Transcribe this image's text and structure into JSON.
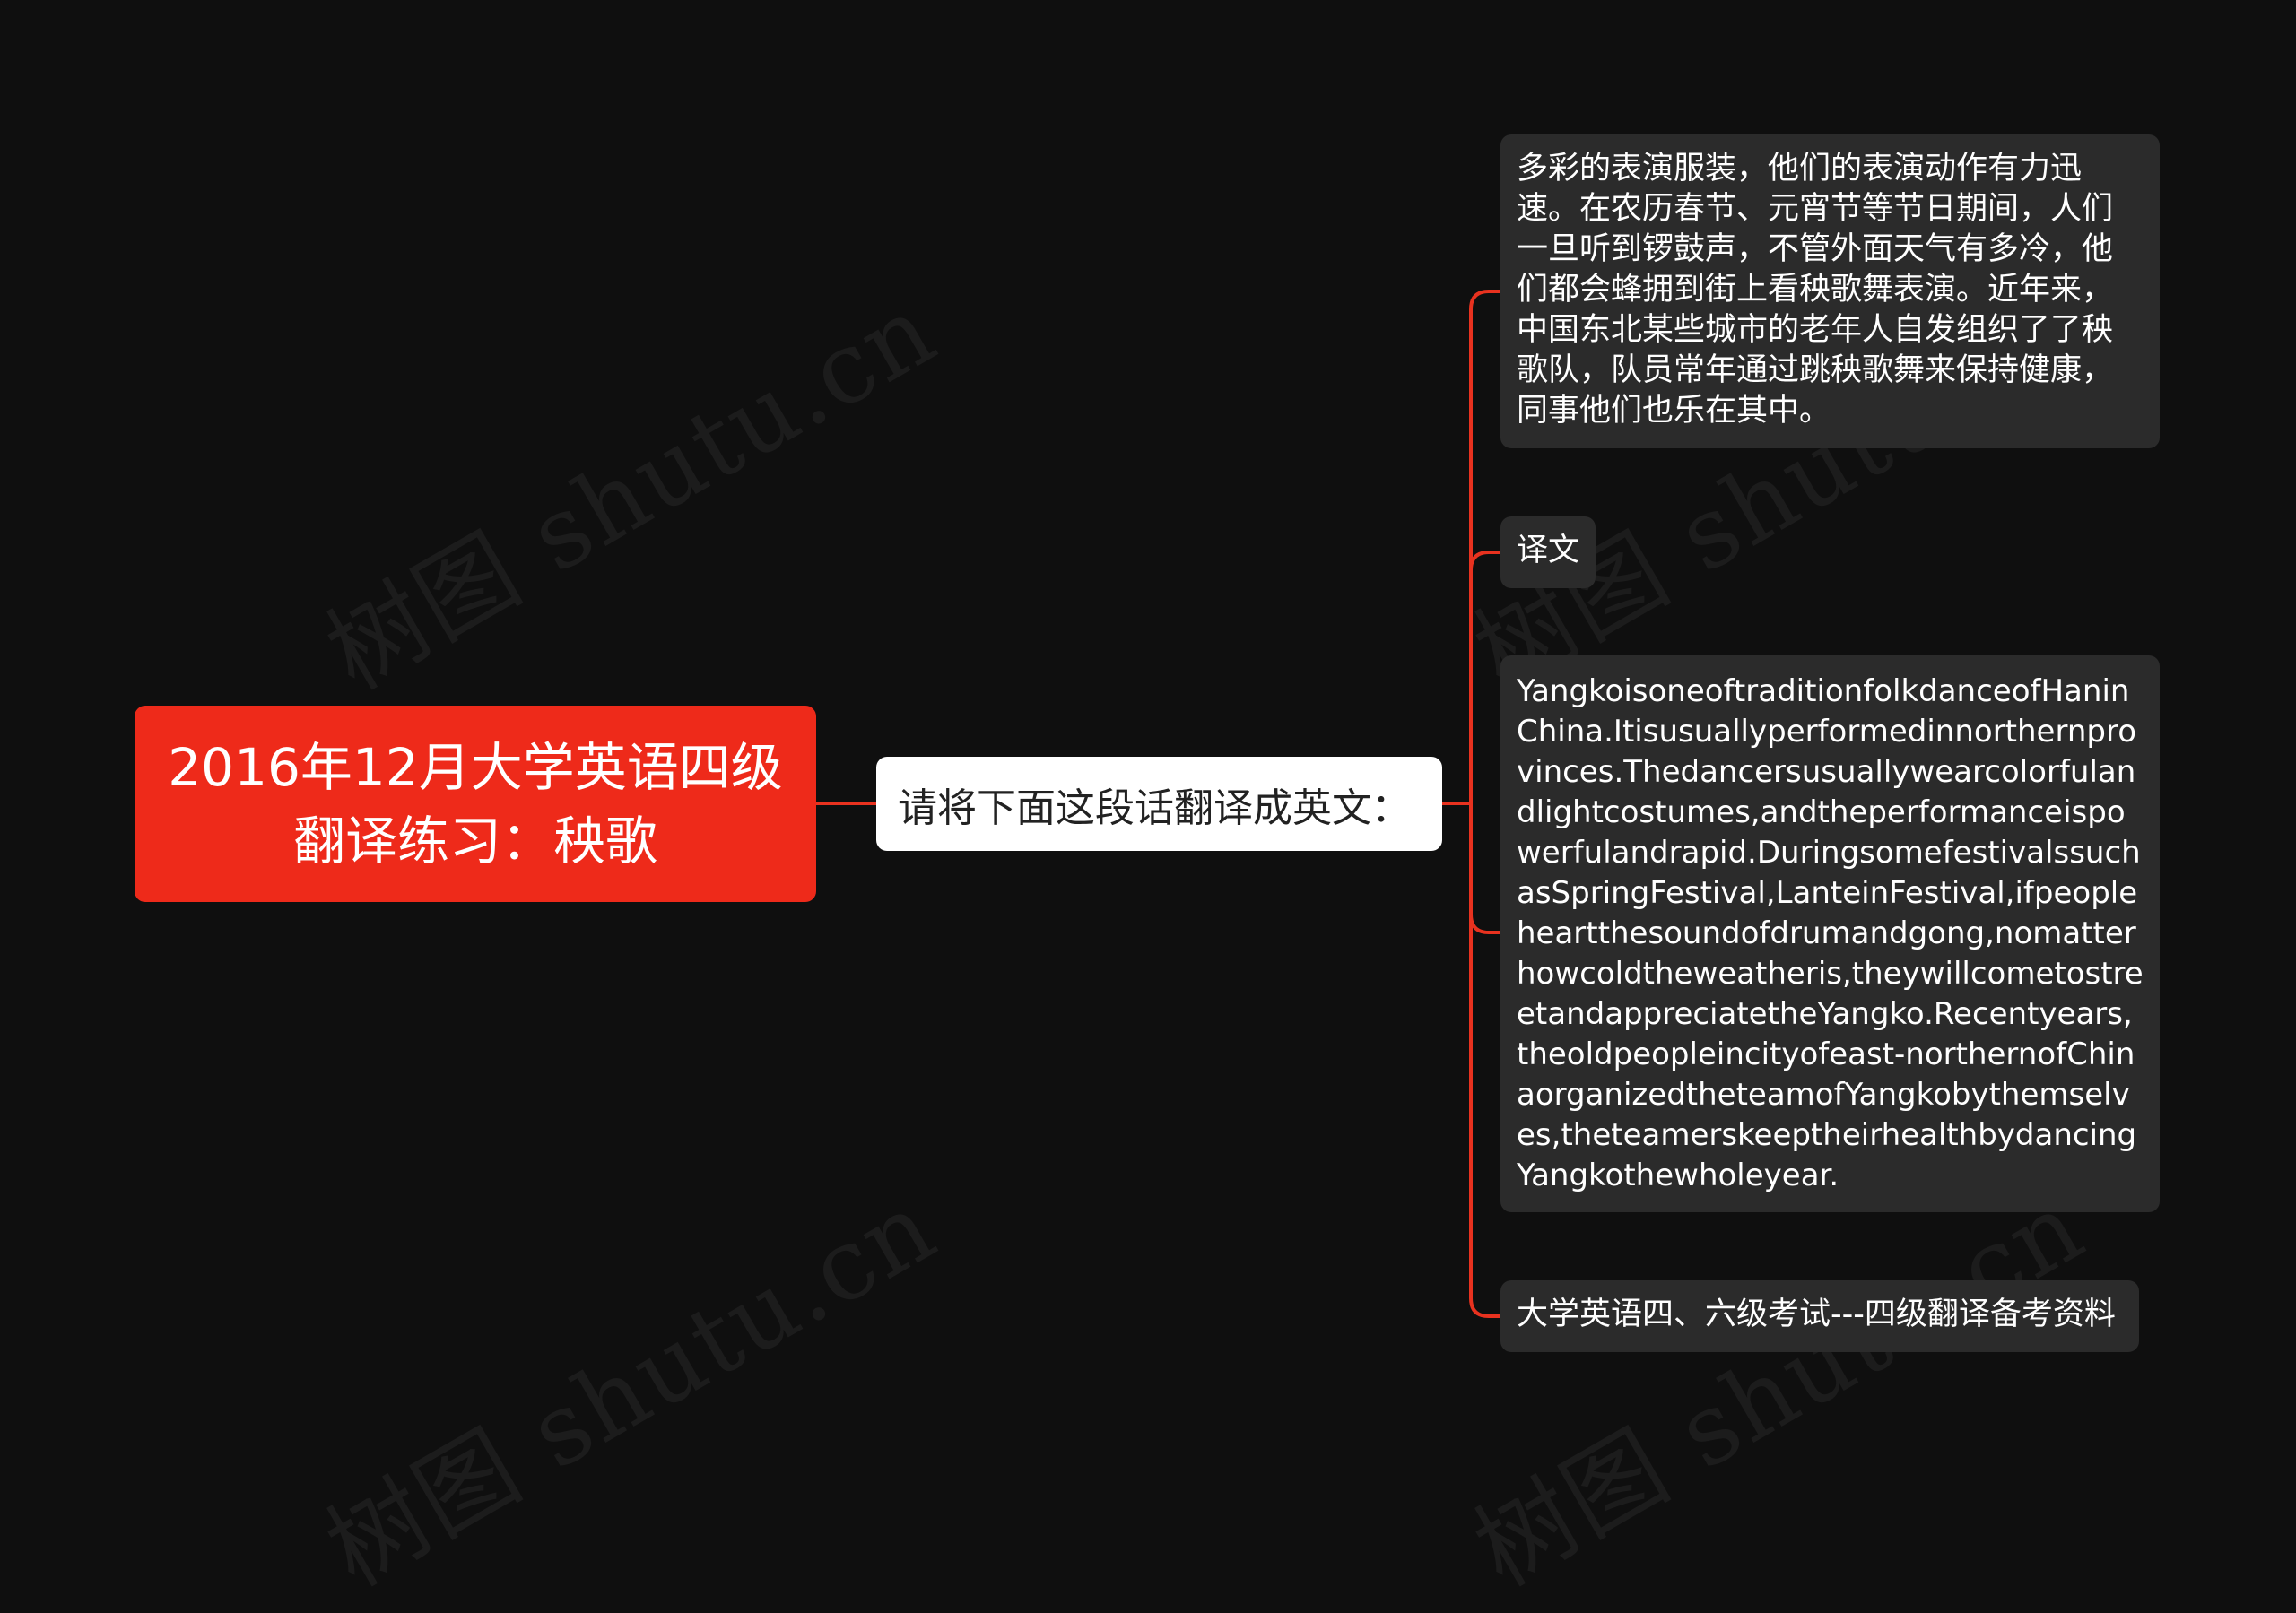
{
  "watermark": "树图 shutu.cn",
  "colors": {
    "background": "#0f0f0f",
    "root_fill": "#ee2a1a",
    "connector": "#e8321f",
    "leaf_fill": "#2b2b2b"
  },
  "mindmap": {
    "root": {
      "text": "2016年12月大学英语四级翻译练习：秧歌"
    },
    "center": {
      "text": "请将下面这段话翻译成英文："
    },
    "leaves": [
      {
        "text": "多彩的表演服装，他们的表演动作有力迅速。在农历春节、元宵节等节日期间，人们一旦听到锣鼓声，不管外面天气有多冷，他们都会蜂拥到街上看秧歌舞表演。近年来，中国东北某些城市的老年人自发组织了了秧歌队，队员常年通过跳秧歌舞来保持健康，同事他们也乐在其中。"
      },
      {
        "text": "译文"
      },
      {
        "text": "YangkoisoneoftraditionfolkdanceofHaninChina.Itisusuallyperformedinnorthernprovinces.Thedancersusuallywearcolorfulandlightcostumes,andtheperformanceispowerfulandrapid.DuringsomefestivalssuchasSpringFestival,LanteinFestival,ifpeopleheartthesoundofdrumandgong,nomatterhowcoldtheweatheris,theywillcometostreetandappreciatetheYangko.Recentyears,theoldpeopleincityofeast-northernofChinaorganizedtheteamofYangkobythemselves,theteamerskeeptheirhealthbydancingYangkothewholeyear."
      },
      {
        "text": "大学英语四、六级考试---四级翻译备考资料"
      }
    ]
  }
}
